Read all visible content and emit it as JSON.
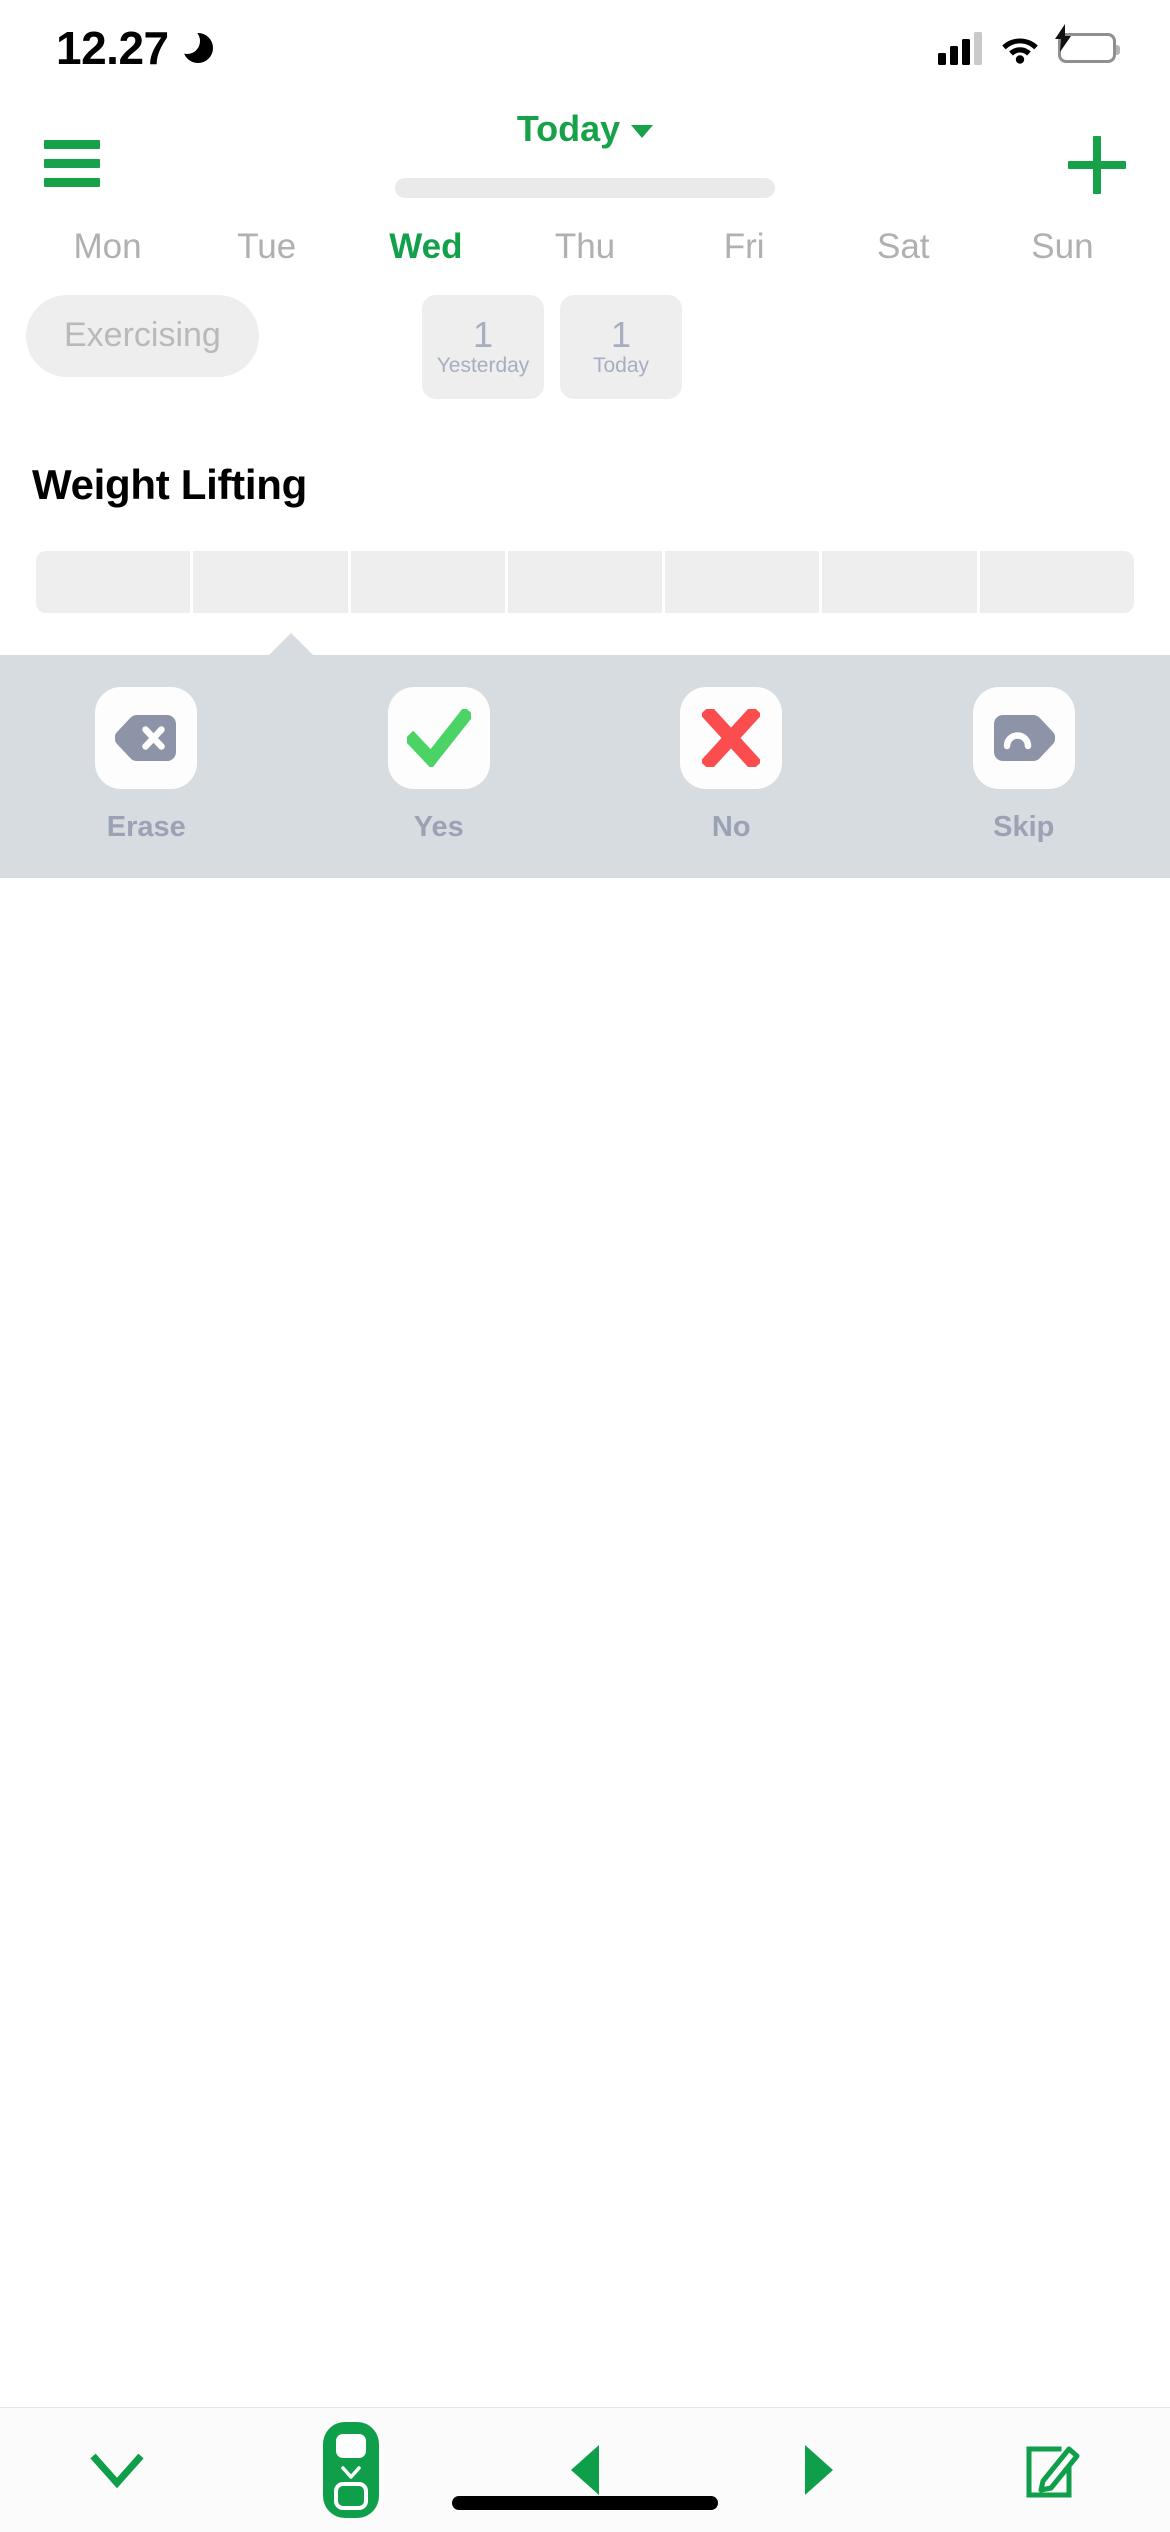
{
  "status_bar": {
    "time": "12.27",
    "icons": [
      "moon-icon",
      "cellular-signal-icon",
      "wifi-icon",
      "battery-charging-icon"
    ]
  },
  "nav": {
    "menu_icon": "hamburger-menu-icon",
    "title": "Today",
    "dropdown_icon": "chevron-down-icon",
    "add_icon": "plus-icon"
  },
  "week": {
    "days": [
      {
        "label": "Mon",
        "active": false
      },
      {
        "label": "Tue",
        "active": false
      },
      {
        "label": "Wed",
        "active": true
      },
      {
        "label": "Thu",
        "active": false
      },
      {
        "label": "Fri",
        "active": false
      },
      {
        "label": "Sat",
        "active": false
      },
      {
        "label": "Sun",
        "active": false
      }
    ]
  },
  "filters": {
    "tag_chip": "Exercising"
  },
  "stats": [
    {
      "value": "1",
      "label": "Yesterday"
    },
    {
      "value": "1",
      "label": "Today"
    }
  ],
  "habit": {
    "name": "Weight Lifting",
    "cells": [
      "",
      "",
      "",
      "",
      "",
      "",
      ""
    ]
  },
  "action_popover": {
    "actions": [
      {
        "label": "Erase",
        "icon": "backspace-delete-icon",
        "color": "#8d94a8"
      },
      {
        "label": "Yes",
        "icon": "checkmark-icon",
        "color": "#4cd366"
      },
      {
        "label": "No",
        "icon": "cross-x-icon",
        "color": "#fb4d4d"
      },
      {
        "label": "Skip",
        "icon": "skip-tag-icon",
        "color": "#8d94a8"
      }
    ]
  },
  "bottom_toolbar": {
    "items": [
      {
        "name": "collapse-chevron-down-icon"
      },
      {
        "name": "reorder-move-icon"
      },
      {
        "name": "previous-triangle-left-icon"
      },
      {
        "name": "next-triangle-right-icon"
      },
      {
        "name": "edit-compose-icon"
      }
    ]
  },
  "colors": {
    "brand_green": "#17a24a",
    "popover_bg": "#d7dce1",
    "cell_gray": "#eeeeee",
    "label_slate": "#9aa2b4"
  }
}
